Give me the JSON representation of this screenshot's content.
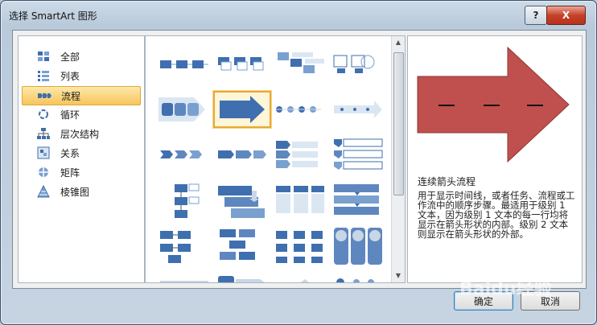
{
  "window": {
    "title": "选择 SmartArt 图形",
    "help_label": "?",
    "close_label": "X"
  },
  "categories": [
    {
      "label": "全部",
      "icon": "all-icon"
    },
    {
      "label": "列表",
      "icon": "list-icon"
    },
    {
      "label": "流程",
      "icon": "process-icon",
      "selected": true
    },
    {
      "label": "循环",
      "icon": "cycle-icon"
    },
    {
      "label": "层次结构",
      "icon": "hierarchy-icon"
    },
    {
      "label": "关系",
      "icon": "relationship-icon"
    },
    {
      "label": "矩阵",
      "icon": "matrix-icon"
    },
    {
      "label": "棱锥图",
      "icon": "pyramid-icon"
    }
  ],
  "preview": {
    "title": "连续箭头流程",
    "description": "用于显示时间线，或者任务、流程或工作流中的顺序步骤。最适用于级别 1 文本，因为级别 1 文本的每一行均将显示在箭头形状的内部。级别 2 文本则显示在箭头形状的外部。",
    "arrow_color": "#c0504d"
  },
  "buttons": {
    "ok": "确定",
    "cancel": "取消"
  },
  "watermark": "Baidu经验"
}
